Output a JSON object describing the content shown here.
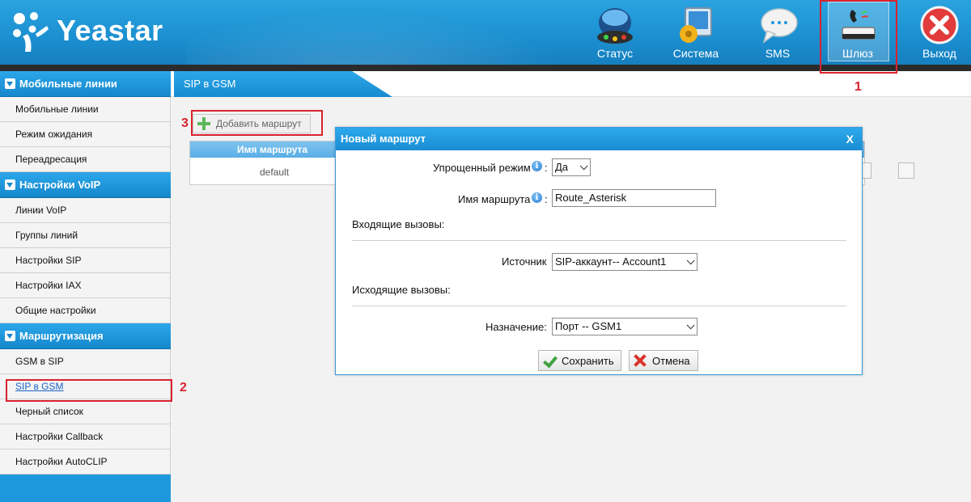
{
  "header": {
    "logo_text": "Yeastar",
    "nav": [
      {
        "label": "Статус",
        "icon": "status-icon"
      },
      {
        "label": "Система",
        "icon": "system-icon"
      },
      {
        "label": "SMS",
        "icon": "sms-icon"
      },
      {
        "label": "Шлюз",
        "icon": "gateway-icon",
        "active": true
      },
      {
        "label": "Выход",
        "icon": "exit-icon"
      }
    ]
  },
  "annotations": {
    "step1": "1",
    "step2": "2",
    "step3": "3",
    "color": "#d9232d"
  },
  "sidebar": {
    "sections": [
      {
        "title": "Мобильные линии",
        "items": [
          "Мобильные линии",
          "Режим ожидания",
          "Переадресация"
        ]
      },
      {
        "title": "Настройки VoIP",
        "items": [
          "Линии VoIP",
          "Группы линий",
          "Настройки SIP",
          "Настройки IAX",
          "Общие настройки"
        ]
      },
      {
        "title": "Маршрутизация",
        "items": [
          "GSM в SIP",
          "SIP в GSM",
          "Черный список",
          "Настройки Callback",
          "Настройки AutoCLIP"
        ]
      }
    ],
    "active_item": "SIP в GSM"
  },
  "main": {
    "tab_label": "SIP в GSM",
    "add_route_label": "Добавить маршрут",
    "table": {
      "header_name": "Имя маршрута",
      "rows": [
        {
          "name": "default"
        }
      ]
    }
  },
  "dialog": {
    "title": "Новый маршрут",
    "close_label": "X",
    "simple_mode_label": "Упрощенный режим",
    "simple_mode_value": "Да",
    "route_name_label": "Имя маршрута",
    "route_name_value": "Route_Asterisk",
    "incoming_label": "Входящие вызовы:",
    "source_label": "Источник",
    "source_value": "SIP-аккаунт-- Account1",
    "outgoing_label": "Исходящие вызовы:",
    "destination_label": "Назначение:",
    "destination_value": "Порт -- GSM1",
    "save_label": "Сохранить",
    "cancel_label": "Отмена"
  },
  "colors": {
    "accent": "#1e98dc",
    "annotation_red": "#d9232d"
  }
}
